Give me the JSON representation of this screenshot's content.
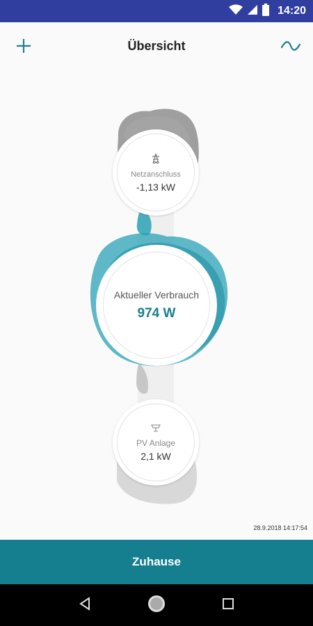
{
  "status_bar": {
    "time": "14:20",
    "icons": [
      "wifi-icon",
      "signal-icon",
      "battery-icon"
    ]
  },
  "header": {
    "title": "Übersicht",
    "add_icon": "plus-icon",
    "chart_icon": "wave-icon"
  },
  "flow": {
    "grid": {
      "label": "Netzanschluss",
      "value": "-1,13 kW",
      "icon": "power-pylon-icon"
    },
    "consumption": {
      "label": "Aktueller Verbrauch",
      "value": "974 W"
    },
    "pv": {
      "label": "PV Anlage",
      "value": "2,1 kW",
      "icon": "solar-panel-icon"
    },
    "timestamp": "28.9.2018 14:17:54"
  },
  "bottom_bar": {
    "label": "Zuhause"
  },
  "nav_bar": {
    "icons": [
      "back-icon",
      "home-icon",
      "recents-icon"
    ]
  },
  "colors": {
    "accent": "#157f8f",
    "status_bar": "#303f9f",
    "blob_teal": "#2aa2b5",
    "blob_gray": "#8a8a8a"
  }
}
